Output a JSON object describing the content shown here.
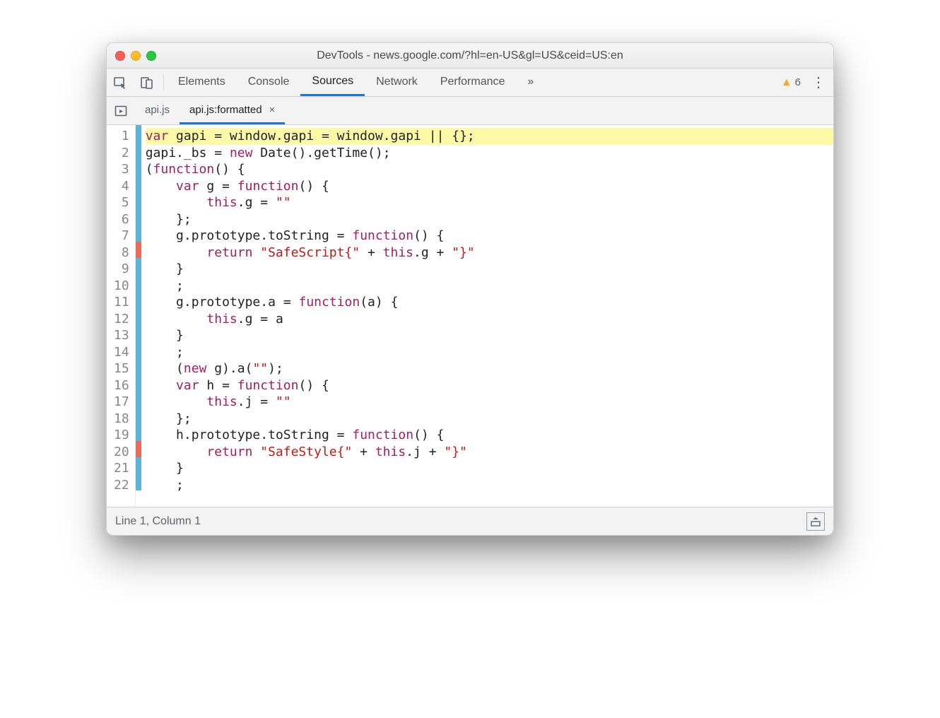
{
  "window": {
    "title": "DevTools - news.google.com/?hl=en-US&gl=US&ceid=US:en"
  },
  "toolbar": {
    "tabs": [
      "Elements",
      "Console",
      "Sources",
      "Network",
      "Performance"
    ],
    "active": "Sources",
    "more": "»",
    "warning_count": "6"
  },
  "file_tabs": {
    "items": [
      {
        "label": "api.js",
        "active": false,
        "closable": false
      },
      {
        "label": "api.js:formatted",
        "active": true,
        "closable": true
      }
    ],
    "close_glyph": "×"
  },
  "code": {
    "lines": [
      {
        "n": 1,
        "marker": "blue",
        "hl": true,
        "tokens": [
          [
            "kw",
            "var "
          ],
          [
            "ident",
            "gapi "
          ],
          [
            "punct",
            "= "
          ],
          [
            "ident",
            "window"
          ],
          [
            "punct",
            "."
          ],
          [
            "ident",
            "gapi "
          ],
          [
            "punct",
            "= "
          ],
          [
            "ident",
            "window"
          ],
          [
            "punct",
            "."
          ],
          [
            "ident",
            "gapi "
          ],
          [
            "punct",
            "|| {};"
          ]
        ]
      },
      {
        "n": 2,
        "marker": "blue",
        "tokens": [
          [
            "ident",
            "gapi"
          ],
          [
            "punct",
            "."
          ],
          [
            "ident",
            "_bs "
          ],
          [
            "punct",
            "= "
          ],
          [
            "kw",
            "new "
          ],
          [
            "ident",
            "Date"
          ],
          [
            "punct",
            "()."
          ],
          [
            "ident",
            "getTime"
          ],
          [
            "punct",
            "();"
          ]
        ]
      },
      {
        "n": 3,
        "marker": "blue",
        "tokens": [
          [
            "punct",
            "("
          ],
          [
            "kw",
            "function"
          ],
          [
            "punct",
            "() {"
          ]
        ]
      },
      {
        "n": 4,
        "marker": "blue",
        "tokens": [
          [
            "punct",
            "    "
          ],
          [
            "kw",
            "var "
          ],
          [
            "ident",
            "g "
          ],
          [
            "punct",
            "= "
          ],
          [
            "kw",
            "function"
          ],
          [
            "punct",
            "() {"
          ]
        ]
      },
      {
        "n": 5,
        "marker": "blue",
        "tokens": [
          [
            "punct",
            "        "
          ],
          [
            "kw",
            "this"
          ],
          [
            "punct",
            "."
          ],
          [
            "ident",
            "g "
          ],
          [
            "punct",
            "= "
          ],
          [
            "str",
            "\"\""
          ]
        ]
      },
      {
        "n": 6,
        "marker": "blue",
        "tokens": [
          [
            "punct",
            "    };"
          ]
        ]
      },
      {
        "n": 7,
        "marker": "blue",
        "tokens": [
          [
            "punct",
            "    "
          ],
          [
            "ident",
            "g"
          ],
          [
            "punct",
            "."
          ],
          [
            "ident",
            "prototype"
          ],
          [
            "punct",
            "."
          ],
          [
            "ident",
            "toString "
          ],
          [
            "punct",
            "= "
          ],
          [
            "kw",
            "function"
          ],
          [
            "punct",
            "() {"
          ]
        ]
      },
      {
        "n": 8,
        "marker": "red",
        "tokens": [
          [
            "punct",
            "        "
          ],
          [
            "kw",
            "return "
          ],
          [
            "str",
            "\"SafeScript{\""
          ],
          [
            "punct",
            " + "
          ],
          [
            "kw",
            "this"
          ],
          [
            "punct",
            "."
          ],
          [
            "ident",
            "g"
          ],
          [
            "punct",
            " + "
          ],
          [
            "str",
            "\"}\""
          ]
        ]
      },
      {
        "n": 9,
        "marker": "blue",
        "tokens": [
          [
            "punct",
            "    }"
          ]
        ]
      },
      {
        "n": 10,
        "marker": "blue",
        "tokens": [
          [
            "punct",
            "    ;"
          ]
        ]
      },
      {
        "n": 11,
        "marker": "blue",
        "tokens": [
          [
            "punct",
            "    "
          ],
          [
            "ident",
            "g"
          ],
          [
            "punct",
            "."
          ],
          [
            "ident",
            "prototype"
          ],
          [
            "punct",
            "."
          ],
          [
            "ident",
            "a "
          ],
          [
            "punct",
            "= "
          ],
          [
            "kw",
            "function"
          ],
          [
            "punct",
            "("
          ],
          [
            "ident",
            "a"
          ],
          [
            "punct",
            ") {"
          ]
        ]
      },
      {
        "n": 12,
        "marker": "blue",
        "tokens": [
          [
            "punct",
            "        "
          ],
          [
            "kw",
            "this"
          ],
          [
            "punct",
            "."
          ],
          [
            "ident",
            "g "
          ],
          [
            "punct",
            "= "
          ],
          [
            "ident",
            "a"
          ]
        ]
      },
      {
        "n": 13,
        "marker": "blue",
        "tokens": [
          [
            "punct",
            "    }"
          ]
        ]
      },
      {
        "n": 14,
        "marker": "blue",
        "tokens": [
          [
            "punct",
            "    ;"
          ]
        ]
      },
      {
        "n": 15,
        "marker": "blue",
        "tokens": [
          [
            "punct",
            "    ("
          ],
          [
            "kw",
            "new "
          ],
          [
            "ident",
            "g"
          ],
          [
            "punct",
            ")."
          ],
          [
            "ident",
            "a"
          ],
          [
            "punct",
            "("
          ],
          [
            "str",
            "\"\""
          ],
          [
            "punct",
            ");"
          ]
        ]
      },
      {
        "n": 16,
        "marker": "blue",
        "tokens": [
          [
            "punct",
            "    "
          ],
          [
            "kw",
            "var "
          ],
          [
            "ident",
            "h "
          ],
          [
            "punct",
            "= "
          ],
          [
            "kw",
            "function"
          ],
          [
            "punct",
            "() {"
          ]
        ]
      },
      {
        "n": 17,
        "marker": "blue",
        "tokens": [
          [
            "punct",
            "        "
          ],
          [
            "kw",
            "this"
          ],
          [
            "punct",
            "."
          ],
          [
            "ident",
            "j "
          ],
          [
            "punct",
            "= "
          ],
          [
            "str",
            "\"\""
          ]
        ]
      },
      {
        "n": 18,
        "marker": "blue",
        "tokens": [
          [
            "punct",
            "    };"
          ]
        ]
      },
      {
        "n": 19,
        "marker": "blue",
        "tokens": [
          [
            "punct",
            "    "
          ],
          [
            "ident",
            "h"
          ],
          [
            "punct",
            "."
          ],
          [
            "ident",
            "prototype"
          ],
          [
            "punct",
            "."
          ],
          [
            "ident",
            "toString "
          ],
          [
            "punct",
            "= "
          ],
          [
            "kw",
            "function"
          ],
          [
            "punct",
            "() {"
          ]
        ]
      },
      {
        "n": 20,
        "marker": "red",
        "tokens": [
          [
            "punct",
            "        "
          ],
          [
            "kw",
            "return "
          ],
          [
            "str",
            "\"SafeStyle{\""
          ],
          [
            "punct",
            " + "
          ],
          [
            "kw",
            "this"
          ],
          [
            "punct",
            "."
          ],
          [
            "ident",
            "j"
          ],
          [
            "punct",
            " + "
          ],
          [
            "str",
            "\"}\""
          ]
        ]
      },
      {
        "n": 21,
        "marker": "blue",
        "tokens": [
          [
            "punct",
            "    }"
          ]
        ]
      },
      {
        "n": 22,
        "marker": "blue",
        "tokens": [
          [
            "punct",
            "    ;"
          ]
        ]
      }
    ]
  },
  "status": {
    "position": "Line 1, Column 1"
  }
}
